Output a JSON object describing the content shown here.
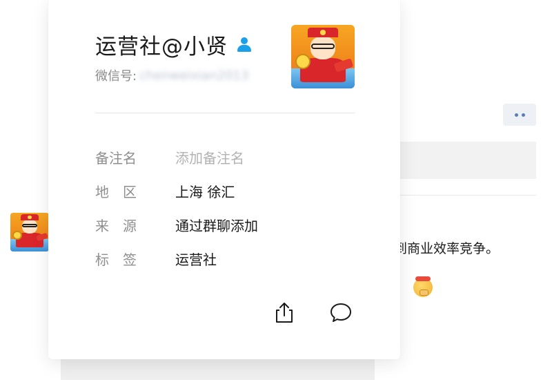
{
  "card": {
    "nickname": "运营社@小贤",
    "wechat_label": "微信号:",
    "wechat_id": "chenweixian2013",
    "rows": [
      {
        "label": "备注名",
        "value": "添加备注名"
      },
      {
        "label": "地　区",
        "value": "上海 徐汇"
      },
      {
        "label": "来　源",
        "value": "通过群聊添加"
      },
      {
        "label": "标　签",
        "value": "运营社"
      }
    ],
    "icons": {
      "verified": "person-icon",
      "share": "share-icon",
      "message": "chat-bubble-icon"
    }
  },
  "chat": {
    "line1": "到商业效率竞争。",
    "line2": "。"
  },
  "colors": {
    "verified_icon": "#1aa0e8",
    "label_gray": "#8e8e8e",
    "placeholder_gray": "#b2b2b2",
    "more_dots": "#5a7db3"
  }
}
